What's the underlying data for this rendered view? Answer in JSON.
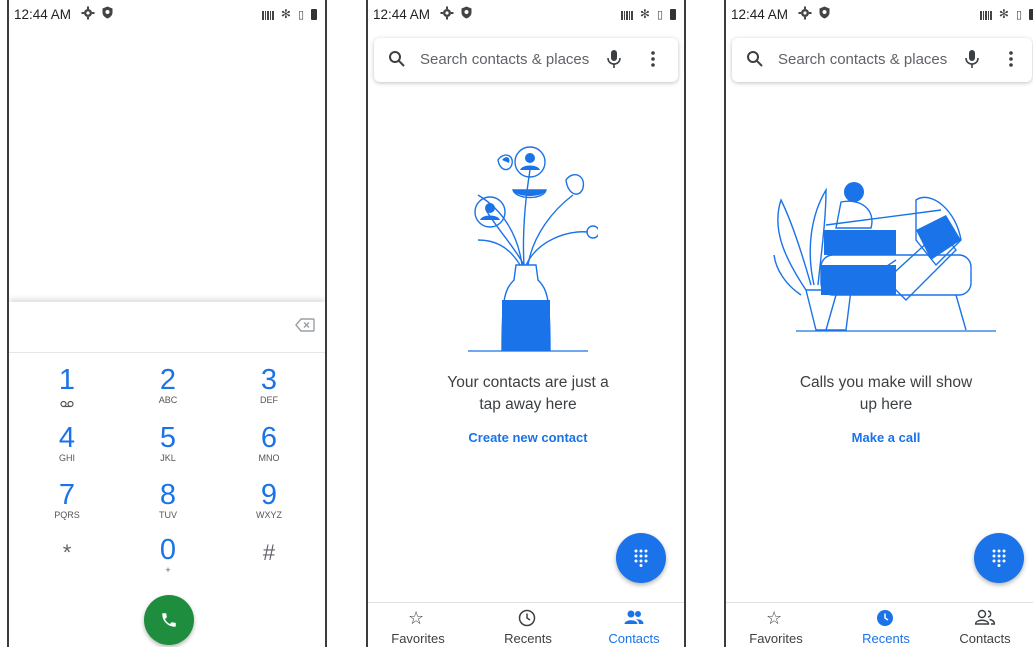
{
  "status_bar": {
    "time": "12:44 AM"
  },
  "dialer": {
    "keys": [
      {
        "digit": "1",
        "letters": "",
        "voicemail": true
      },
      {
        "digit": "2",
        "letters": "ABC"
      },
      {
        "digit": "3",
        "letters": "DEF"
      },
      {
        "digit": "4",
        "letters": "GHI"
      },
      {
        "digit": "5",
        "letters": "JKL"
      },
      {
        "digit": "6",
        "letters": "MNO"
      },
      {
        "digit": "7",
        "letters": "PQRS"
      },
      {
        "digit": "8",
        "letters": "TUV"
      },
      {
        "digit": "9",
        "letters": "WXYZ"
      },
      {
        "digit": "*",
        "letters": ""
      },
      {
        "digit": "0",
        "letters": "+"
      },
      {
        "digit": "#",
        "letters": ""
      }
    ],
    "call_color": "#1e8e3e"
  },
  "contacts_screen": {
    "search_placeholder": "Search contacts & places",
    "empty_line1": "Your contacts are just a",
    "empty_line2": "tap away here",
    "action": "Create new contact"
  },
  "recents_screen": {
    "search_placeholder": "Search contacts & places",
    "empty_line1": "Calls you make will show",
    "empty_line2": "up here",
    "action": "Make a call"
  },
  "nav": {
    "favorites": "Favorites",
    "recents": "Recents",
    "contacts": "Contacts"
  },
  "colors": {
    "accent": "#1a73e8",
    "call": "#1e8e3e"
  }
}
